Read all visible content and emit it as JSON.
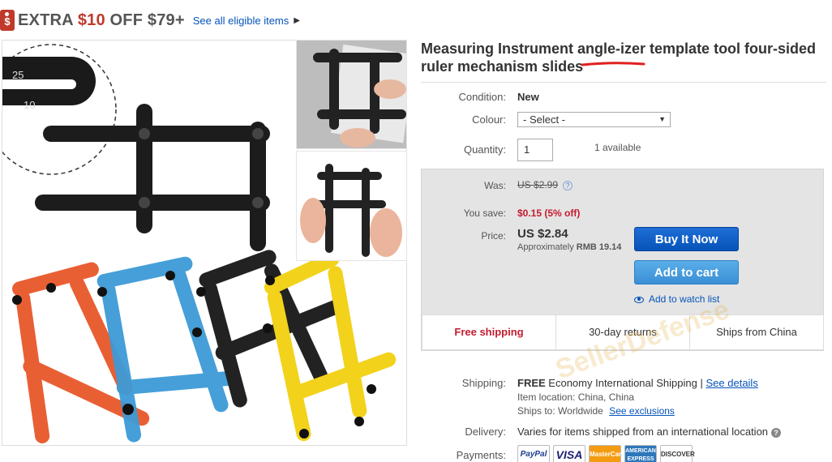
{
  "promo": {
    "prefix": "EXTRA ",
    "amount": "$10",
    "suffix": " OFF $79+",
    "link": "See all eligible items"
  },
  "product": {
    "title": "Measuring Instrument angle-izer template tool four-sided ruler mechanism slides"
  },
  "details": {
    "condition_label": "Condition:",
    "condition_value": "New",
    "colour_label": "Colour:",
    "colour_value": "- Select -",
    "quantity_label": "Quantity:",
    "quantity_value": "1",
    "available": "1 available"
  },
  "pricing": {
    "was_label": "Was:",
    "was_value": "US $2.99",
    "save_label": "You save:",
    "save_value": "$0.15 (5% off)",
    "price_label": "Price:",
    "price_value": "US $2.84",
    "approx_prefix": "Approximately ",
    "approx_value": "RMB 19.14"
  },
  "actions": {
    "buy_now": "Buy It Now",
    "add_cart": "Add to cart",
    "watch": "Add to watch list"
  },
  "shipping_tabs": [
    "Free shipping",
    "30-day returns",
    "Ships from China"
  ],
  "shipping": {
    "label": "Shipping:",
    "free": "FREE",
    "method": "Economy International Shipping",
    "separator": "|",
    "see_details": "See details",
    "location": "Item location: China, China",
    "ships_to_prefix": "Ships to:",
    "ships_to_value": "Worldwide",
    "see_exclusions": "See exclusions"
  },
  "delivery": {
    "label": "Delivery:",
    "value": "Varies for items shipped from an international location"
  },
  "payments": {
    "label": "Payments:",
    "logos": [
      "PayPal",
      "VISA",
      "MasterCard",
      "AMERICAN EXPRESS",
      "DISCOVER"
    ]
  },
  "image": {
    "ruler_tick_1": "25",
    "ruler_tick_2": "10"
  },
  "watermark": "SellerDefense",
  "colors": {
    "accent": "#0654ba",
    "sale_red": "#c41c2f",
    "buy_blue": "#0654ba",
    "cart_blue": "#3a8fd6"
  }
}
